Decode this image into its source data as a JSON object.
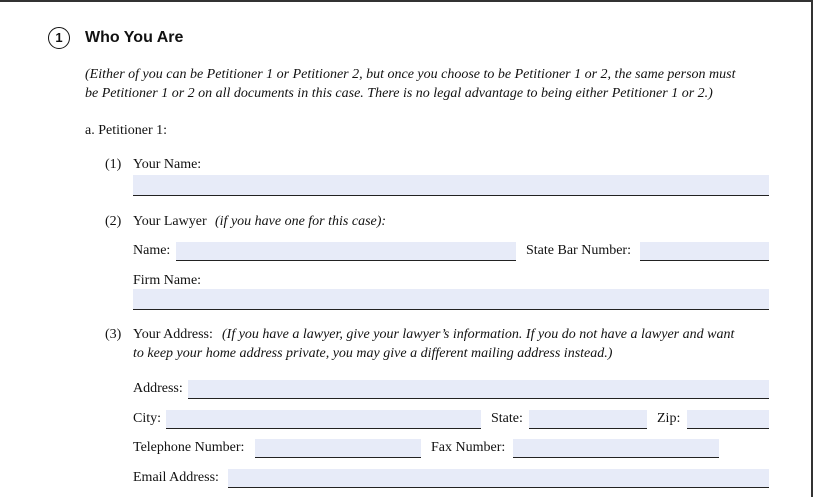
{
  "section": {
    "number": "1",
    "title": "Who You Are",
    "note_line1": "(Either of you can be Petitioner 1 or Petitioner 2, but once you choose to be Petitioner 1 or 2, the same person must",
    "note_line2": "be Petitioner 1 or 2 on all documents in this case. There is no legal advantage to being either Petitioner 1 or 2.)"
  },
  "petitioner": {
    "label": "a.  Petitioner 1:",
    "name_item": {
      "num": "(1)",
      "label": "Your Name:"
    },
    "lawyer_item": {
      "num": "(2)",
      "label": "Your Lawyer",
      "note": "(if you have one for this case):",
      "name_label": "Name:",
      "bar_label": "State Bar Number:",
      "firm_label": "Firm Name:"
    },
    "address_item": {
      "num": "(3)",
      "label": "Your Address:",
      "note_line1": "(If you have a lawyer, give your lawyer’s information. If you do not have a lawyer and want",
      "note_line2": "to keep your home address private, you may give a different mailing address instead.)",
      "address_label": "Address:",
      "city_label": "City:",
      "state_label": "State:",
      "zip_label": "Zip:",
      "phone_label": "Telephone Number:",
      "fax_label": "Fax Number:",
      "email_label": "Email Address:"
    }
  }
}
